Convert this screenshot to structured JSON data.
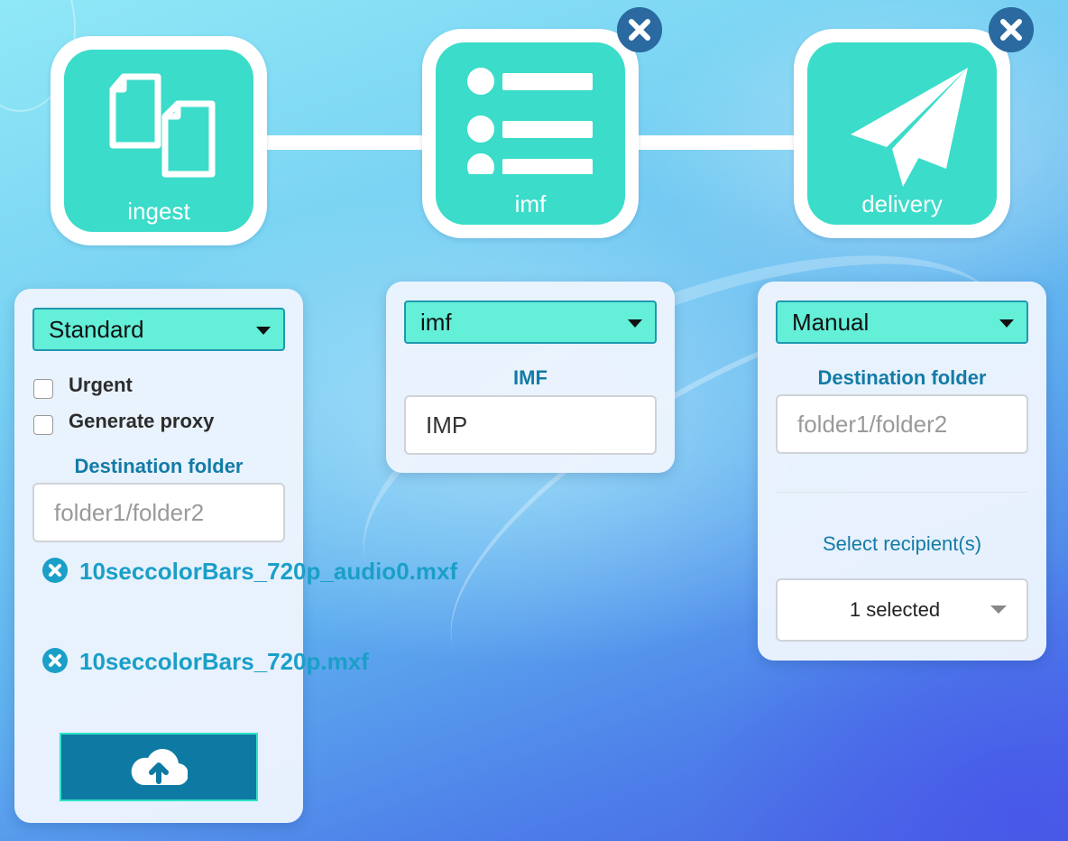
{
  "workflow": {
    "nodes": [
      {
        "label": "ingest",
        "icon": "files-icon"
      },
      {
        "label": "imf",
        "icon": "list-icon"
      },
      {
        "label": "delivery",
        "icon": "paper-plane-icon"
      }
    ],
    "node_color": "#3bdcc9",
    "close_color": "#2a6aa0"
  },
  "ingest_panel": {
    "profile": "Standard",
    "options": [
      {
        "label": "Urgent",
        "checked": false
      },
      {
        "label": "Generate proxy",
        "checked": false
      }
    ],
    "destination_label": "Destination folder",
    "destination_placeholder": "folder1/folder2",
    "files": [
      {
        "name": "10seccolorBars_720p_audio0.mxf"
      },
      {
        "name": "10seccolorBars_720p.mxf"
      }
    ],
    "upload_icon": "cloud-upload-icon"
  },
  "imf_panel": {
    "profile": "imf",
    "field_label": "IMF",
    "field_value": "IMP"
  },
  "delivery_panel": {
    "mode": "Manual",
    "destination_label": "Destination folder",
    "destination_placeholder": "folder1/folder2",
    "recipients_label": "Select recipient(s)",
    "recipients_value": "1 selected"
  },
  "colors": {
    "accent": "#63efd8",
    "link": "#1a9fc8",
    "label": "#137ba7",
    "button": "#0e7aa3"
  }
}
